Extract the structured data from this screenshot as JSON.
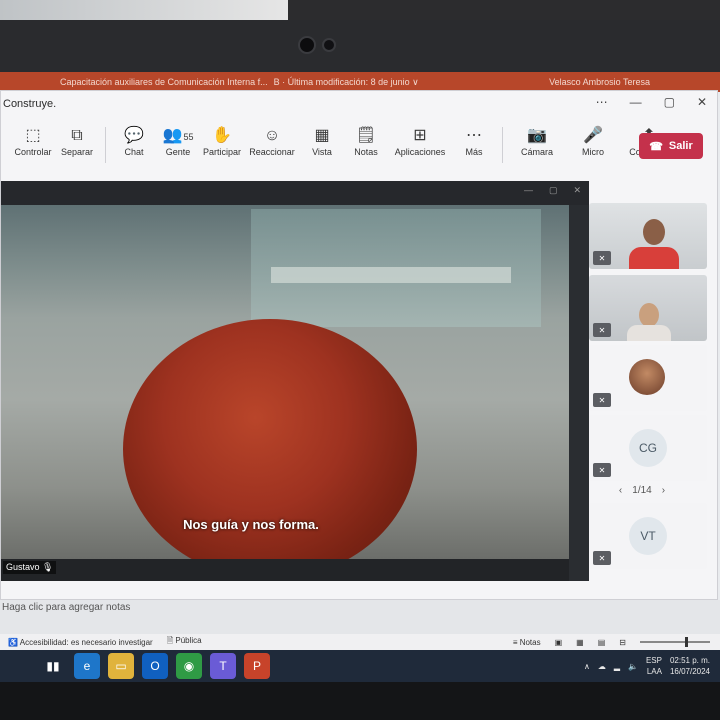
{
  "powerpoint": {
    "title": "Capacitación auxiliares de Comunicación Interna f...",
    "modified": "B · Última modificación: 8 de junio ∨",
    "user": "Velasco Ambrosio Teresa"
  },
  "teams": {
    "window_title": "Construye.",
    "toolbar": [
      {
        "icon": "⬚",
        "label": "Controlar"
      },
      {
        "icon": "⧉",
        "label": "Separar"
      },
      {
        "icon": "💬",
        "label": "Chat"
      },
      {
        "icon": "👥",
        "label": "Gente",
        "count": "55"
      },
      {
        "icon": "✋",
        "label": "Participar"
      },
      {
        "icon": "☺",
        "label": "Reaccionar"
      },
      {
        "icon": "▦",
        "label": "Vista"
      },
      {
        "icon": "🗒",
        "label": "Notas"
      },
      {
        "icon": "⊞",
        "label": "Aplicaciones"
      },
      {
        "icon": "⋯",
        "label": "Más"
      },
      {
        "icon": "📷",
        "label": "Cámara"
      },
      {
        "icon": "🎤",
        "label": "Micro"
      },
      {
        "icon": "⬆",
        "label": "Compartir"
      }
    ],
    "leave_label": "Salir",
    "presenter": "Gustavo",
    "subtitle": "Nos guía y nos forma.",
    "participants": {
      "tiles": [
        {
          "initials": ""
        },
        {
          "initials": ""
        },
        {
          "initials": ""
        },
        {
          "initials": "CG"
        },
        {
          "initials": "VT"
        }
      ],
      "pager": "1/14"
    },
    "notes_placeholder": "Haga clic para agregar notas"
  },
  "status_bar": {
    "accessibility": "Accesibilidad: es necesario investigar",
    "visibility": "Pública",
    "notes_label": "Notas"
  },
  "taskbar": {
    "lang": "ESP",
    "layout": "LAA",
    "time": "02:51 p. m.",
    "date": "16/07/2024"
  },
  "colors": {
    "leave": "#c4314b",
    "ppt_accent": "#b7472a",
    "taskbar": "#1f2a3a"
  }
}
